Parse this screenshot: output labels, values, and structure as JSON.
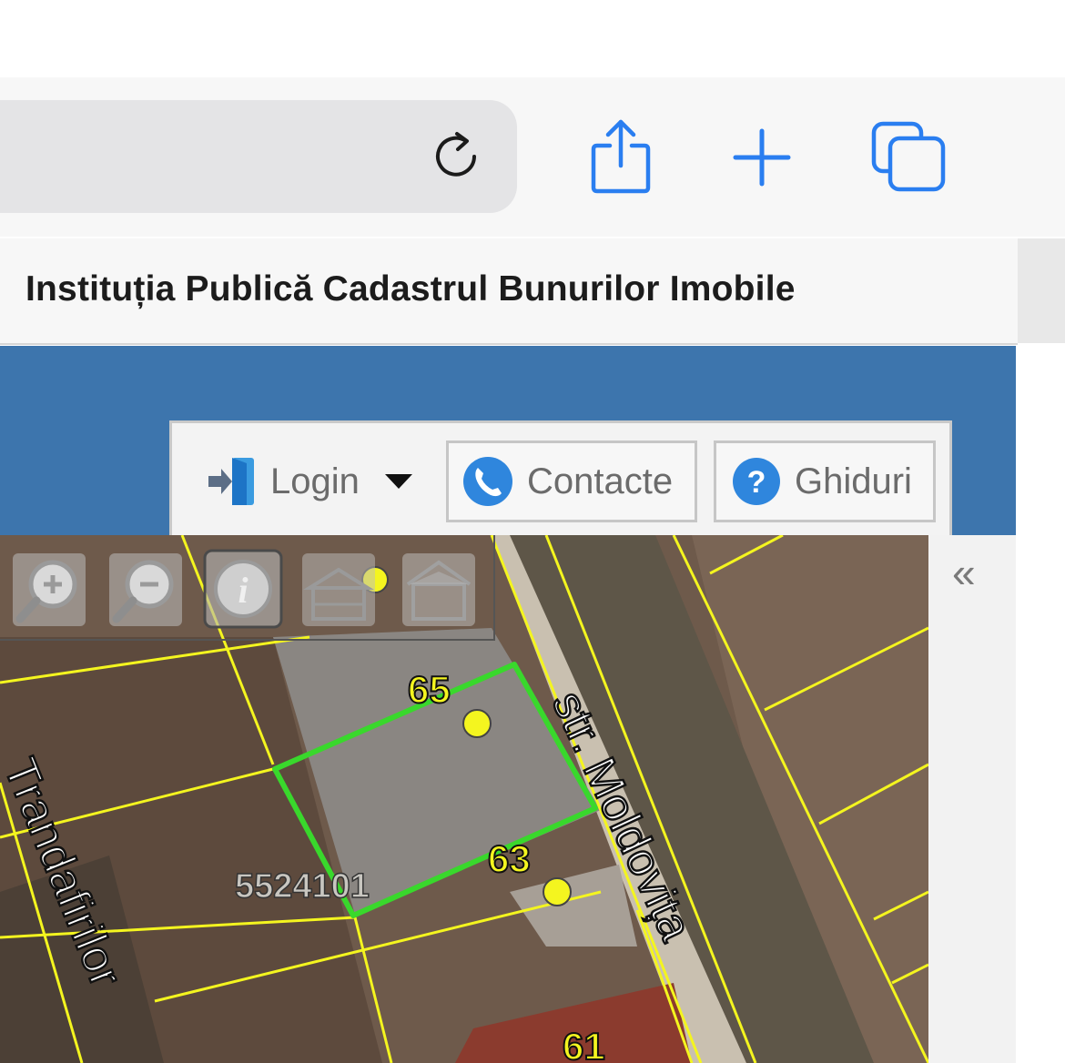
{
  "browser": {
    "icons": [
      "reload-icon",
      "share-icon",
      "new-tab-icon",
      "tabs-icon"
    ],
    "accent_color": "#2a7ef0"
  },
  "page": {
    "title": "Instituția Publică Cadastrul Bunurilor Imobile",
    "banner_color": "#3d75ad"
  },
  "menu": {
    "login_label": "Login",
    "contacts_label": "Contacte",
    "guides_label": "Ghiduri"
  },
  "map": {
    "tools": [
      "zoom-in-icon",
      "zoom-out-icon",
      "info-icon",
      "building-icon",
      "house-icon"
    ],
    "collapse_symbol": "«",
    "house_numbers": [
      "65",
      "63",
      "61"
    ],
    "parcel_id": "5524101",
    "streets": [
      "str. Moldovița",
      "Trandafirilor"
    ],
    "selected_parcel_color": "#39d82c",
    "parcel_line_color": "#f4f51f"
  }
}
